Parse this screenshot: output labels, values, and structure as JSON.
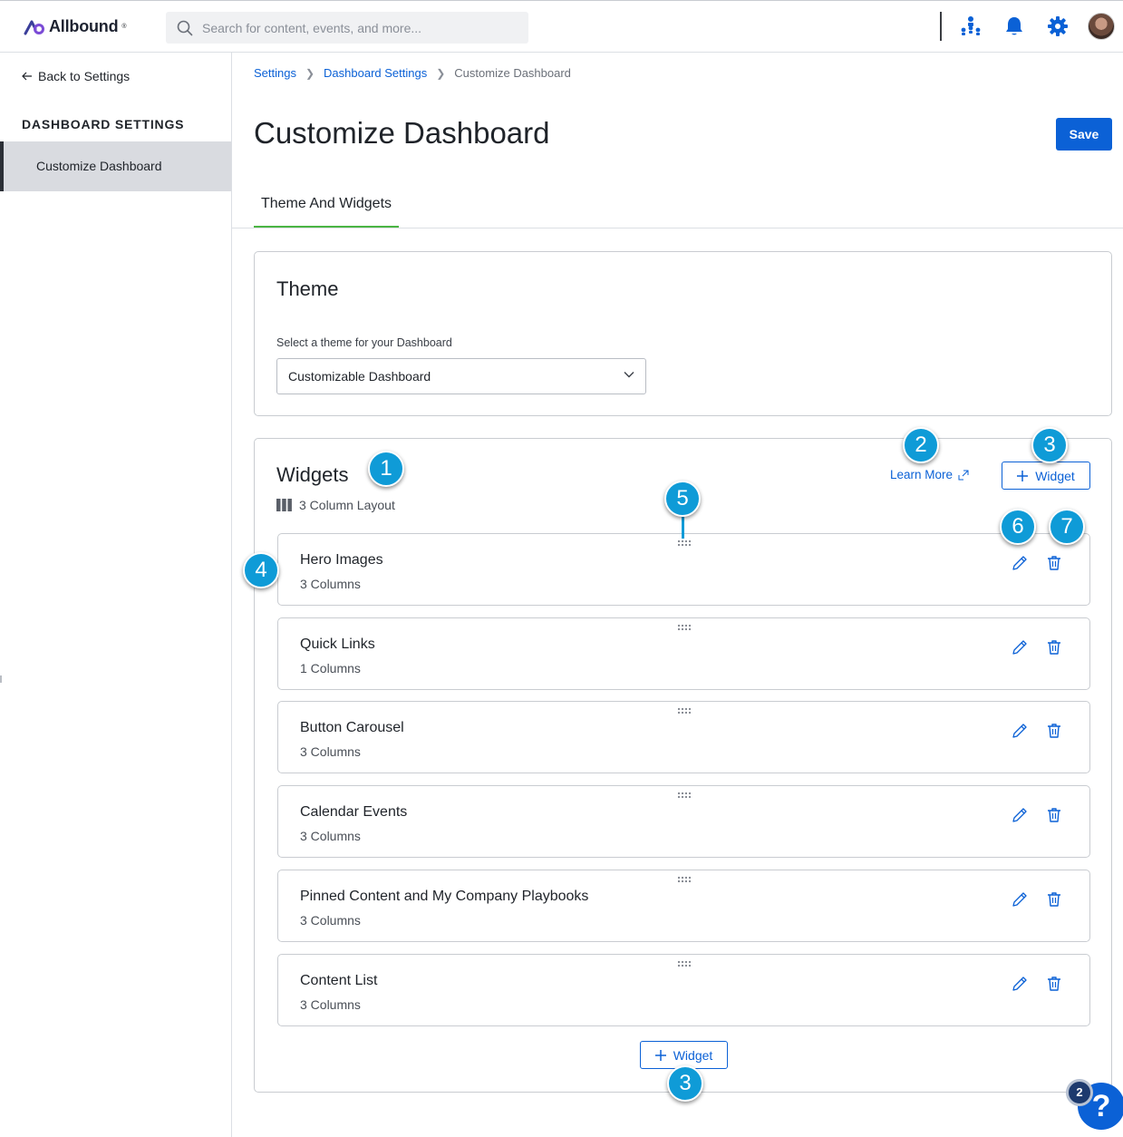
{
  "app": {
    "logo_text": "Allbound",
    "logo_mark": "®"
  },
  "topbar": {
    "search_placeholder": "Search for content, events, and more...",
    "icons": [
      "org-chart-icon",
      "bell-icon",
      "gear-icon",
      "avatar"
    ]
  },
  "sidebar": {
    "back_label": "Back to Settings",
    "section_heading": "DASHBOARD SETTINGS",
    "items": [
      {
        "label": "Customize Dashboard",
        "active": true
      }
    ]
  },
  "breadcrumb": {
    "items": [
      "Settings",
      "Dashboard Settings",
      "Customize Dashboard"
    ]
  },
  "page": {
    "title": "Customize Dashboard",
    "save_label": "Save",
    "tabs": [
      {
        "label": "Theme And Widgets",
        "active": true
      }
    ]
  },
  "theme": {
    "title": "Theme",
    "field_label": "Select a theme for your Dashboard",
    "selected_value": "Customizable Dashboard"
  },
  "widgets": {
    "title": "Widgets",
    "layout_label": "3 Column Layout",
    "learn_more_label": "Learn More",
    "add_widget_label": "Widget",
    "items": [
      {
        "name": "Hero Images",
        "columns": "3 Columns"
      },
      {
        "name": "Quick Links",
        "columns": "1 Columns"
      },
      {
        "name": "Button Carousel",
        "columns": "3 Columns"
      },
      {
        "name": "Calendar Events",
        "columns": "3 Columns"
      },
      {
        "name": "Pinned Content and My Company Playbooks",
        "columns": "3 Columns"
      },
      {
        "name": "Content List",
        "columns": "3 Columns"
      }
    ]
  },
  "callouts": [
    "1",
    "2",
    "3",
    "4",
    "5",
    "6",
    "7",
    "3"
  ],
  "help": {
    "glyph": "?",
    "count": "2"
  },
  "colors": {
    "primary": "#0b61d6",
    "tab_underline": "#4bb543",
    "callout": "#0f9bd7"
  }
}
